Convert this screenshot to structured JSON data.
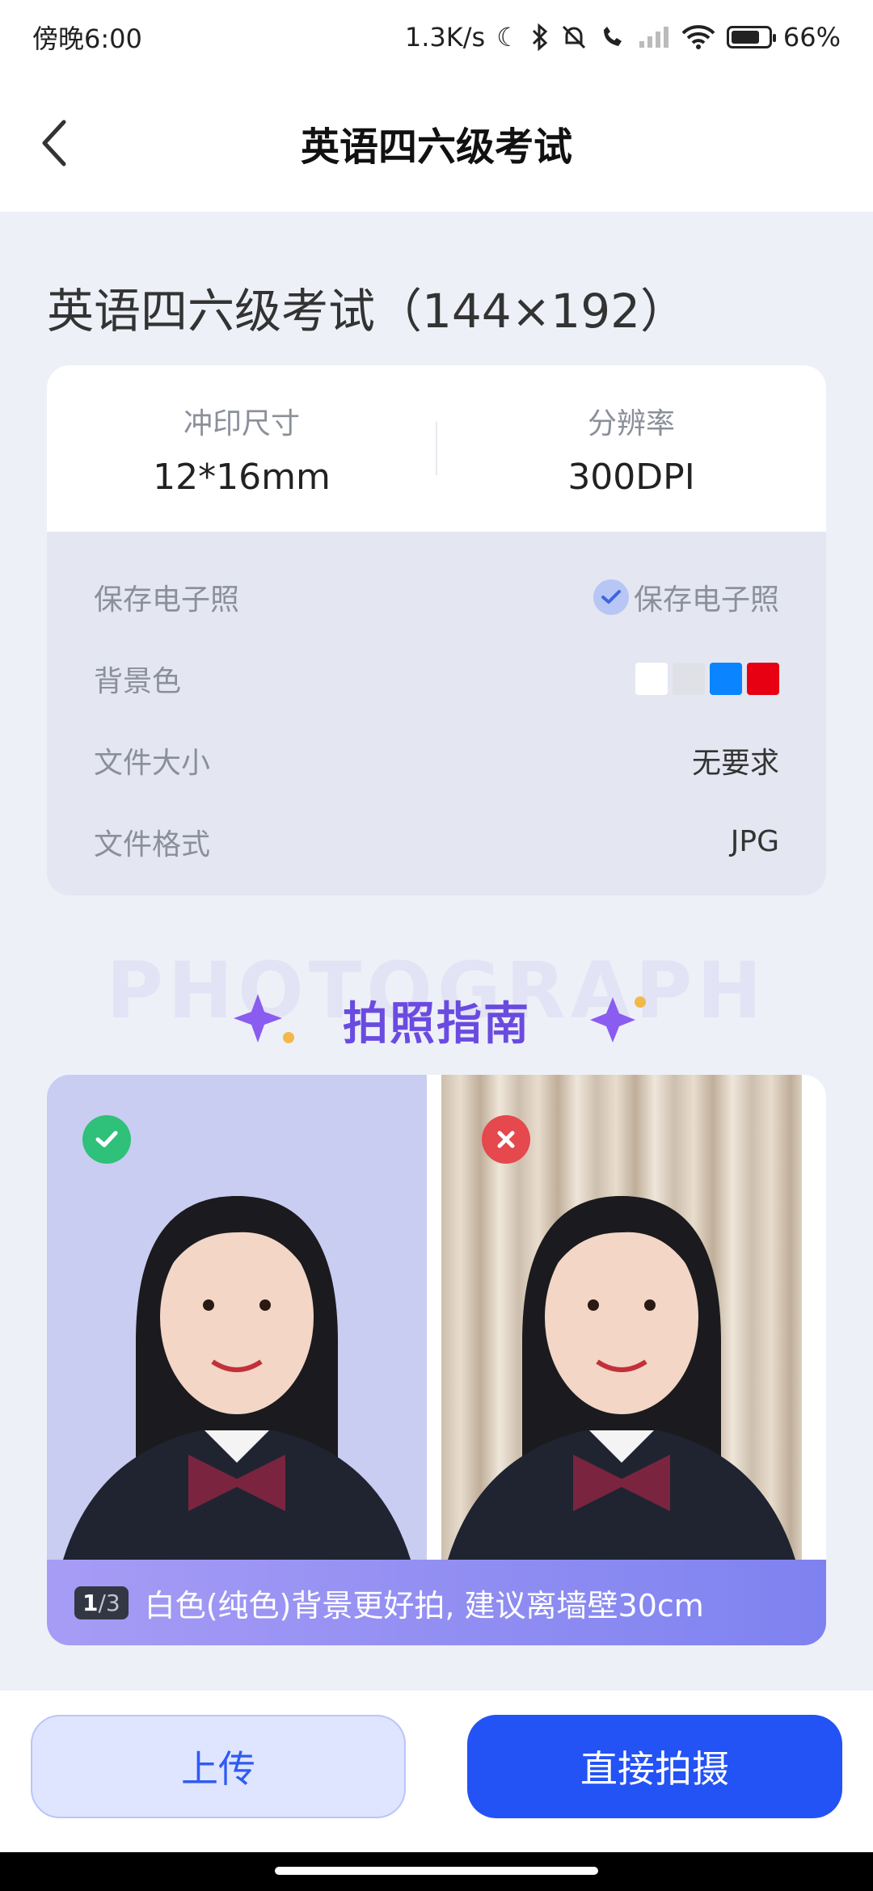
{
  "status_bar": {
    "time": "傍晚6:00",
    "network_speed": "1.3K/s",
    "battery_percent": "66%",
    "icons": [
      "moon-icon",
      "bluetooth-icon",
      "mute-icon",
      "call-icon",
      "signal-icon",
      "wifi-icon",
      "battery-icon"
    ]
  },
  "nav": {
    "title": "英语四六级考试",
    "back_icon": "chevron-left-icon"
  },
  "page": {
    "title": "英语四六级考试（144×192）"
  },
  "spec": {
    "print_size_label": "冲印尺寸",
    "print_size_value": "12*16mm",
    "resolution_label": "分辨率",
    "resolution_value": "300DPI",
    "rows": [
      {
        "label": "保存电子照",
        "value": "保存电子照"
      },
      {
        "label": "背景色",
        "value": ""
      },
      {
        "label": "文件大小",
        "value": "无要求"
      },
      {
        "label": "文件格式",
        "value": "JPG"
      }
    ],
    "background_colors": [
      "#ffffff",
      "#dfe1e6",
      "#0a84ff",
      "#e60012"
    ],
    "save_checked": true
  },
  "guide": {
    "watermark": "PHOTOGRAPH",
    "title": "拍照指南",
    "good_icon": "check-icon",
    "bad_icon": "cross-icon",
    "pager_current": "1",
    "pager_total": "/3",
    "caption": "白色(纯色)背景更好拍, 建议离墙壁30cm"
  },
  "actions": {
    "upload_label": "上传",
    "shoot_label": "直接拍摄"
  },
  "colors": {
    "accent": "#2352f5",
    "guide_purple": "#6a4be0",
    "good_green": "#2fc07a",
    "bad_red": "#e5484d"
  }
}
